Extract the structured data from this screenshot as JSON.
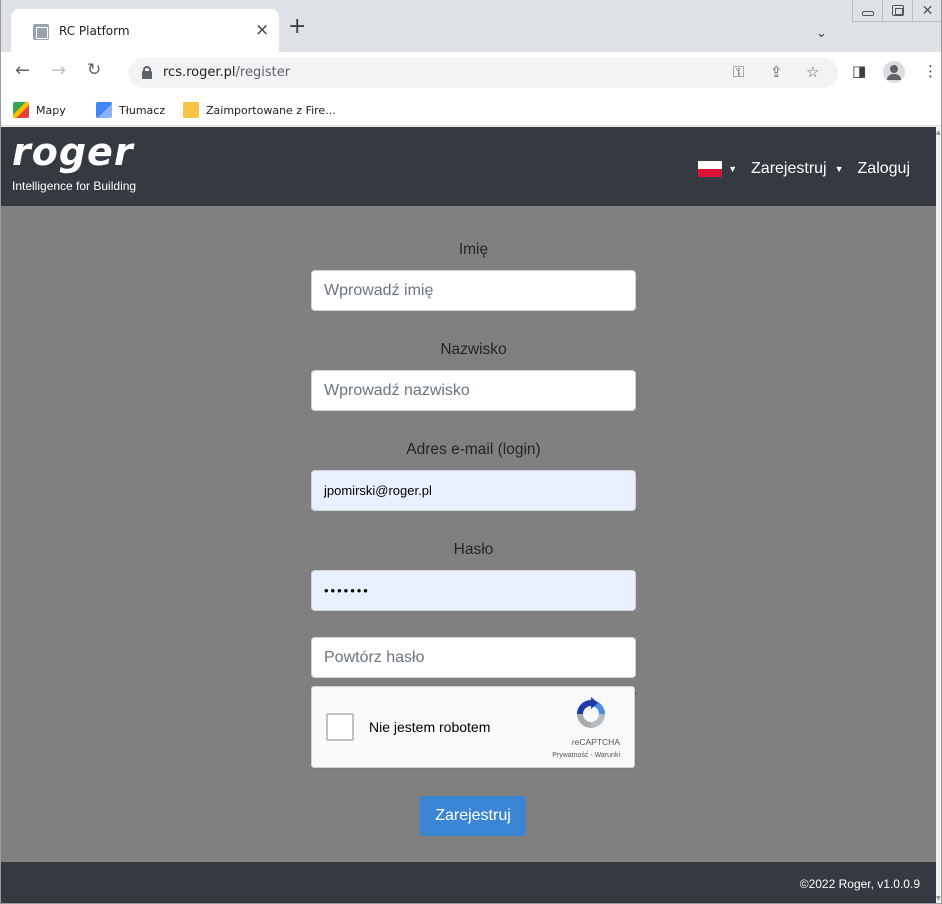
{
  "browser": {
    "tab_title": "RC Platform",
    "tab_close": "×",
    "new_tab": "+",
    "tab_search": "⌄",
    "url_host": "rcs.roger.pl",
    "url_path": "/register",
    "bookmarks": [
      {
        "label": "Mapy",
        "icon": "maps-icon"
      },
      {
        "label": "Tłumacz",
        "icon": "translate-icon"
      },
      {
        "label": "Zaimportowane z Fire...",
        "icon": "folder-icon"
      }
    ]
  },
  "header": {
    "logo": "roger",
    "tagline": "Intelligence for Building",
    "language_flag": "pl-flag",
    "register_label": "Zarejestruj",
    "login_label": "Zaloguj"
  },
  "form": {
    "first_name": {
      "label": "Imię",
      "placeholder": "Wprowadź imię",
      "value": ""
    },
    "last_name": {
      "label": "Nazwisko",
      "placeholder": "Wprowadź nazwisko",
      "value": ""
    },
    "email": {
      "label": "Adres e-mail (login)",
      "value": "jpomirski@roger.pl"
    },
    "password": {
      "label": "Hasło",
      "value": "•••••••"
    },
    "repeat_password": {
      "placeholder": "Powtórz hasło",
      "value": ""
    },
    "captcha": {
      "label": "Nie jestem robotem",
      "brand": "reCAPTCHA",
      "links": "Prywatność - Warunki",
      "checked": false
    },
    "submit_label": "Zarejestruj"
  },
  "footer": {
    "copyright": "©2022 Roger, v1.0.0.9"
  },
  "colors": {
    "header_bg": "#343a40",
    "page_bg": "#808080",
    "primary": "#3a86d4",
    "autofill_bg": "#e8f0fe"
  }
}
